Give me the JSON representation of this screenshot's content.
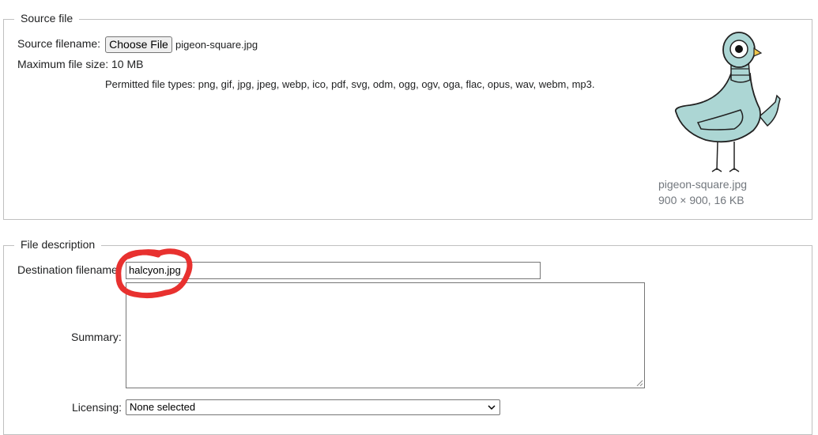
{
  "source_section": {
    "legend": "Source file",
    "filename_label": "Source filename:",
    "choose_button": "Choose File",
    "chosen_file": "pigeon-square.jpg",
    "max_size": "Maximum file size: 10 MB",
    "permitted_types": "Permitted file types: png, gif, jpg, jpeg, webp, ico, pdf, svg, odm, ogg, ogv, oga, flac, opus, wav, webm, mp3.",
    "thumbnail": {
      "icon": "pigeon-illustration",
      "name": "pigeon-square.jpg",
      "info": "900 × 900, 16 KB"
    }
  },
  "description_section": {
    "legend": "File description",
    "destination_label": "Destination filename:",
    "destination_value": "halcyon.jpg",
    "summary_label": "Summary:",
    "summary_value": "",
    "licensing_label": "Licensing:",
    "licensing_selected": "None selected"
  },
  "colors": {
    "annotation": "#e8312f",
    "pigeon_body": "#acd6d4"
  }
}
